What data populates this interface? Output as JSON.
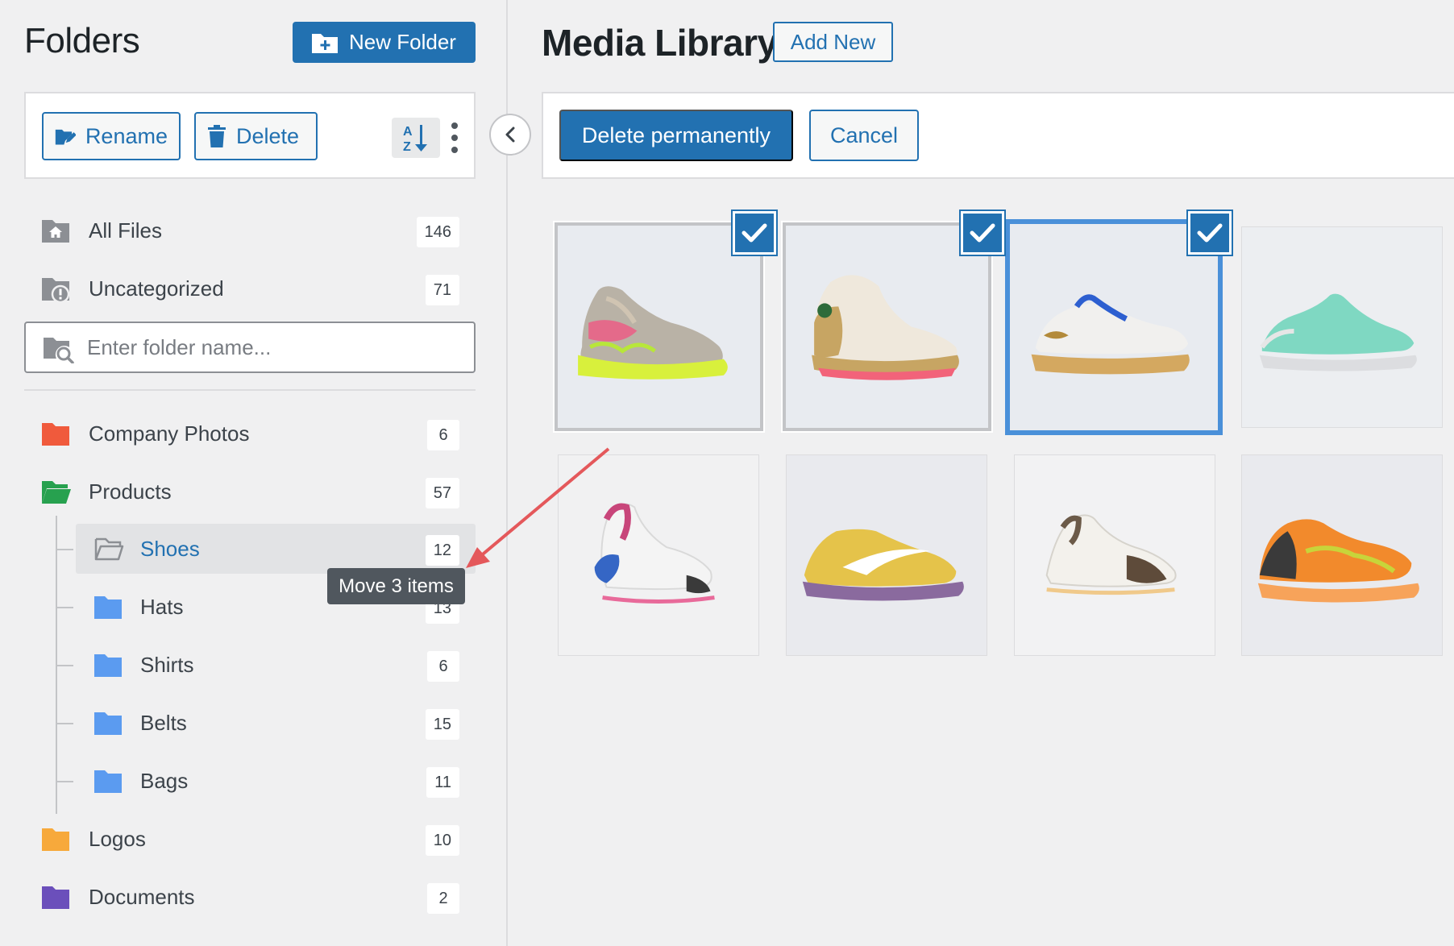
{
  "sidebar": {
    "title": "Folders",
    "new_folder_label": "New Folder",
    "toolbar": {
      "rename_label": "Rename",
      "delete_label": "Delete"
    },
    "search_placeholder": "Enter folder name...",
    "system_folders": [
      {
        "label": "All Files",
        "count": "146",
        "icon": "home-folder-icon"
      },
      {
        "label": "Uncategorized",
        "count": "71",
        "icon": "uncategorized-folder-icon"
      }
    ],
    "folders": [
      {
        "label": "Company Photos",
        "count": "6",
        "color": "#f05a3c"
      },
      {
        "label": "Products",
        "count": "57",
        "color": "#27a14f"
      },
      {
        "label": "Shoes",
        "count": "12",
        "color": "#8c8f94"
      },
      {
        "label": "Hats",
        "count": "13",
        "color": "#5b9bf0"
      },
      {
        "label": "Shirts",
        "count": "6",
        "color": "#5b9bf0"
      },
      {
        "label": "Belts",
        "count": "15",
        "color": "#5b9bf0"
      },
      {
        "label": "Bags",
        "count": "11",
        "color": "#5b9bf0"
      },
      {
        "label": "Logos",
        "count": "10",
        "color": "#f7a93b"
      },
      {
        "label": "Documents",
        "count": "2",
        "color": "#6b4fbb"
      }
    ],
    "tooltip": "Move 3 items"
  },
  "main": {
    "title": "Media Library",
    "add_new_label": "Add New",
    "bulk": {
      "delete_label": "Delete permanently",
      "cancel_label": "Cancel"
    },
    "media": [
      {
        "name": "volt-pink-sneaker",
        "selected": true
      },
      {
        "name": "cream-gold-basketball-shoe",
        "selected": true
      },
      {
        "name": "white-blue-trainer",
        "selected": true
      },
      {
        "name": "mint-trainer",
        "selected": false
      },
      {
        "name": "pink-white-chunky-sneaker",
        "selected": false
      },
      {
        "name": "yellow-purple-low-sneaker",
        "selected": false
      },
      {
        "name": "white-brown-runner",
        "selected": false
      },
      {
        "name": "orange-black-runner",
        "selected": false
      }
    ]
  },
  "colors": {
    "accent": "#2271b1",
    "background": "#f0f0f1",
    "selection_border": "#4a90d9",
    "annotation_arrow": "#e4585b"
  }
}
